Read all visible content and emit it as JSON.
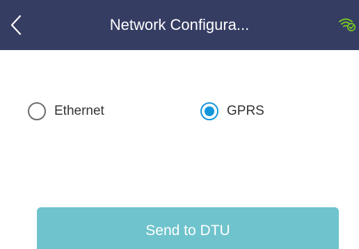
{
  "header": {
    "title": "Network Configura...",
    "back_icon": "chevron-left-icon",
    "status_icon": "wifi-connected-icon",
    "background_color": "#363d63",
    "status_icon_color": "#7cd320"
  },
  "network_type": {
    "options": [
      {
        "label": "Ethernet",
        "selected": false
      },
      {
        "label": "GPRS",
        "selected": true
      }
    ],
    "selected_value": "GPRS",
    "accent_color": "#1296db"
  },
  "actions": {
    "send_label": "Send to DTU",
    "send_button_color": "#6fc3cd"
  }
}
